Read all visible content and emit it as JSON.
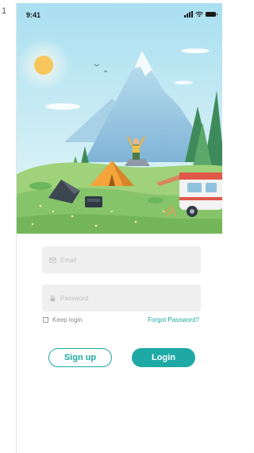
{
  "page_index": "1",
  "status_bar": {
    "time": "9:41"
  },
  "form": {
    "email_placeholder": "Email",
    "password_placeholder": "Password",
    "keep_login_label": "Keep login",
    "forgot_password_label": "Forgot Password?",
    "signup_label": "Sign up",
    "login_label": "Login"
  },
  "colors": {
    "accent": "#1fa9a4",
    "sky": "#a9dff0",
    "grass": "#86c46a"
  },
  "icons": [
    "signal-icon",
    "wifi-icon",
    "battery-icon",
    "mail-icon",
    "lock-icon"
  ]
}
